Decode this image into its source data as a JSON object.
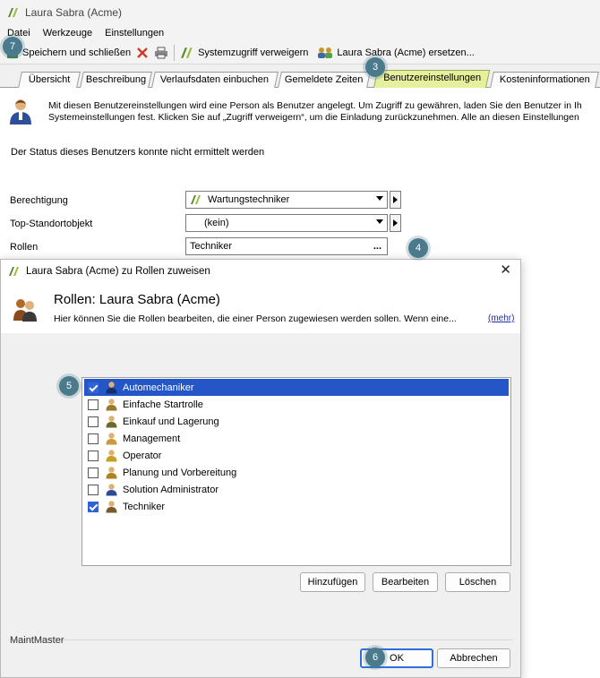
{
  "window": {
    "title": "Laura Sabra (Acme)"
  },
  "menu": [
    "Datei",
    "Werkzeuge",
    "Einstellungen"
  ],
  "toolbar": {
    "save_close": "Speichern und schließen",
    "deny_access": "Systemzugriff verweigern",
    "replace": "Laura Sabra (Acme) ersetzen..."
  },
  "tabs": [
    "Übersicht",
    "Beschreibung",
    "Verlaufsdaten einbuchen",
    "Gemeldete Zeiten",
    "Benutzereinstellungen",
    "Kosteninformationen"
  ],
  "active_tab": "Benutzereinstellungen",
  "info": {
    "line1": "Mit diesen Benutzereinstellungen wird eine Person als Benutzer angelegt. Um Zugriff zu gewähren, laden Sie den Benutzer in Ih",
    "line2": "Systemeinstellungen fest. Klicken Sie auf „Zugriff verweigern“, um die Einladung zurückzunehmen. Alle an diesen Einstellungen"
  },
  "status": "Der Status dieses Benutzers konnte nicht ermittelt werden",
  "form": {
    "permission_label": "Berechtigung",
    "permission_value": "Wartungstechniker",
    "top_site_label": "Top-Standortobjekt",
    "top_site_value": "(kein)",
    "roles_label": "Rollen",
    "roles_value": "Techniker",
    "roles_browse": "..."
  },
  "dialog": {
    "title": "Laura Sabra (Acme) zu Rollen zuweisen",
    "close": "✕",
    "heading": "Rollen: Laura Sabra (Acme)",
    "description": "Hier können Sie die Rollen bearbeiten, die einer Person zugewiesen werden sollen. Wenn eine...",
    "more": "(mehr)",
    "roles": [
      {
        "name": "Automechaniker",
        "checked": true,
        "selected": true
      },
      {
        "name": "Einfache Startrolle",
        "checked": false,
        "selected": false
      },
      {
        "name": "Einkauf und Lagerung",
        "checked": false,
        "selected": false
      },
      {
        "name": "Management",
        "checked": false,
        "selected": false
      },
      {
        "name": "Operator",
        "checked": false,
        "selected": false
      },
      {
        "name": "Planung und Vorbereitung",
        "checked": false,
        "selected": false
      },
      {
        "name": "Solution Administrator",
        "checked": false,
        "selected": false
      },
      {
        "name": "Techniker",
        "checked": true,
        "selected": false
      }
    ],
    "add": "Hinzufügen",
    "edit": "Bearbeiten",
    "delete": "Löschen",
    "ok": "OK",
    "cancel": "Abbrechen",
    "brand": "MaintMaster"
  },
  "callouts": [
    "3",
    "4",
    "5",
    "6",
    "7"
  ],
  "colors": {
    "active_tab": "#e6ef9c",
    "selection": "#2456c7",
    "callout": "#4a7a8c",
    "link": "#1e2eb0"
  }
}
